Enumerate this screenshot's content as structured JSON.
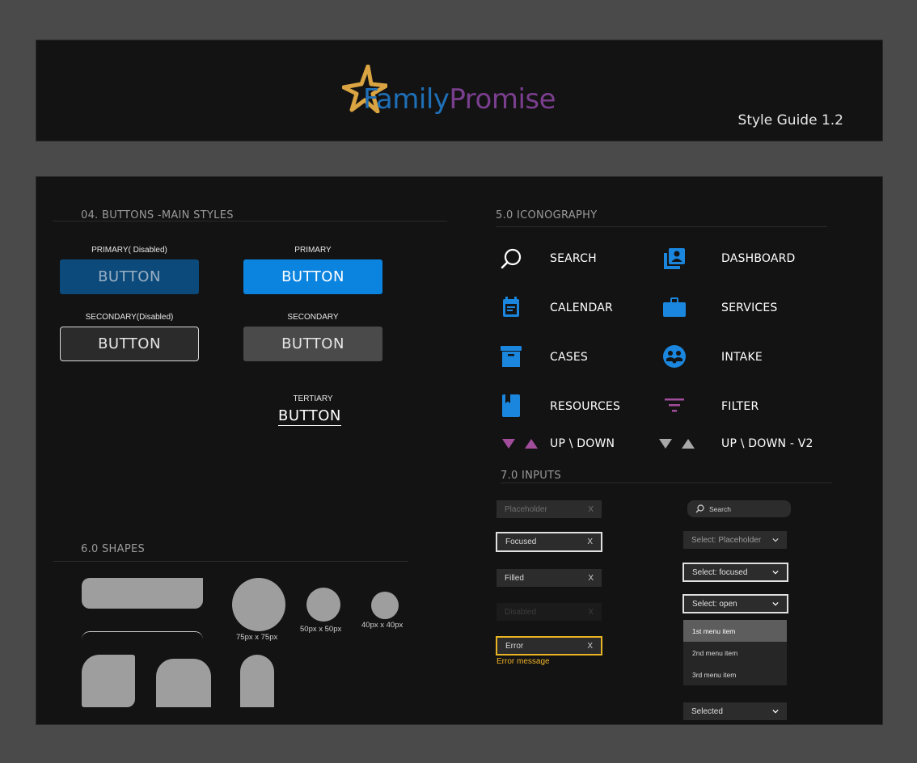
{
  "header": {
    "logo_family": "Family",
    "logo_promise": "Promise",
    "guide_title": "Style Guide 1.2"
  },
  "colors": {
    "primary_blue": "#0b84e0",
    "primary_blue_disabled": "#0c4a7b",
    "icon_blue": "#1a86de",
    "accent_purple": "#a14d9c",
    "error_yellow": "#e8b423",
    "logo_gold": "#d9a441",
    "background": "#131313"
  },
  "buttons": {
    "section_title": "04. BUTTONS -MAIN STYLES",
    "primary_disabled": {
      "caption": "PRIMARY( Disabled)",
      "label": "BUTTON"
    },
    "primary": {
      "caption": "PRIMARY",
      "label": "BUTTON"
    },
    "secondary_disabled": {
      "caption": "SECONDARY(Disabled)",
      "label": "BUTTON"
    },
    "secondary": {
      "caption": "SECONDARY",
      "label": "BUTTON"
    },
    "tertiary": {
      "caption": "TERTIARY",
      "label": "BUTTON"
    }
  },
  "iconography": {
    "section_title": "5.0 ICONOGRAPHY",
    "items": [
      {
        "label": "SEARCH",
        "icon": "search-icon"
      },
      {
        "label": "DASHBOARD",
        "icon": "dashboard-icon"
      },
      {
        "label": "CALENDAR",
        "icon": "calendar-icon"
      },
      {
        "label": "SERVICES",
        "icon": "briefcase-icon"
      },
      {
        "label": "CASES",
        "icon": "archive-box-icon"
      },
      {
        "label": "INTAKE",
        "icon": "intake-people-icon"
      },
      {
        "label": "RESOURCES",
        "icon": "bookmark-book-icon"
      },
      {
        "label": "FILTER",
        "icon": "filter-icon"
      },
      {
        "label": "UP \\ DOWN",
        "icon": "up-down-triangles-icon"
      },
      {
        "label": "UP \\ DOWN - V2",
        "icon": "up-down-triangles-v2-icon"
      }
    ]
  },
  "shapes": {
    "section_title": "6.0 SHAPES",
    "circle_large_caption": "75px x 75px",
    "circle_medium_caption": "50px x 50px",
    "circle_small_caption": "40px x 40px"
  },
  "inputs": {
    "section_title": "7.0 INPUTS",
    "placeholder": {
      "text": "Placeholder",
      "clear": "X"
    },
    "focused": {
      "text": "Focused",
      "clear": "X"
    },
    "filled": {
      "text": "Filled",
      "clear": "X"
    },
    "disabled": {
      "text": "Disabled",
      "clear": "X"
    },
    "error": {
      "text": "Error",
      "clear": "X",
      "message": "Error message"
    },
    "search": {
      "text": "Search"
    },
    "select_placeholder": "Select: Placeholder",
    "select_focused": "Select: focused",
    "select_open": "Select: open",
    "menu_items": [
      "1st menu item",
      "2nd menu item",
      "3rd menu item"
    ],
    "select_selected": "Selected"
  }
}
